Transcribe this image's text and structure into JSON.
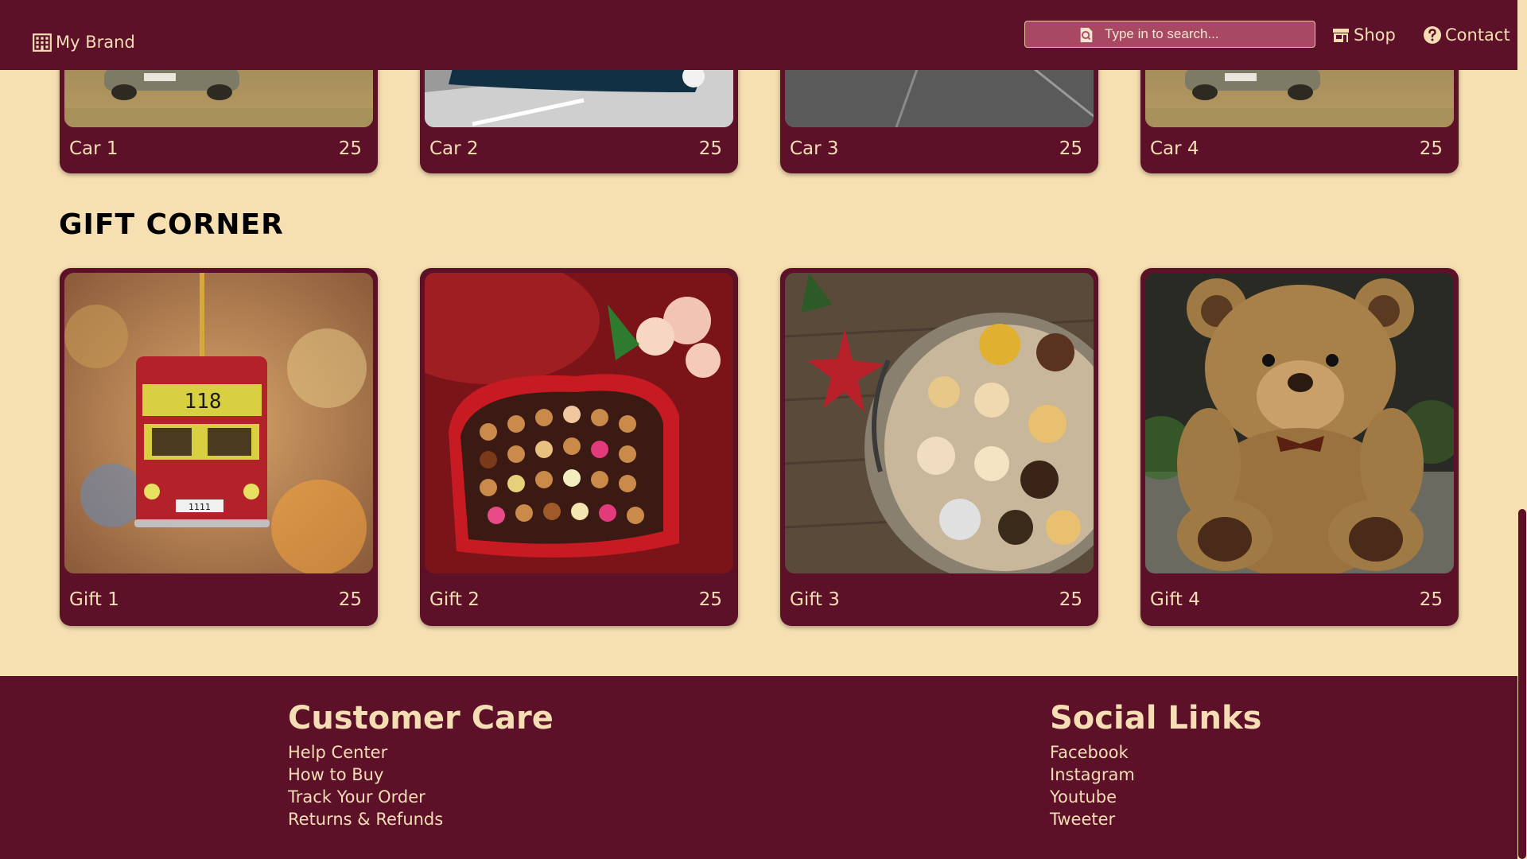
{
  "nav": {
    "brand": "My Brand",
    "search_placeholder": "Type in to search...",
    "shop": "Shop",
    "contact": "Contact"
  },
  "cars": [
    {
      "name": "Car 1",
      "price": "25"
    },
    {
      "name": "Car 2",
      "price": "25"
    },
    {
      "name": "Car 3",
      "price": "25"
    },
    {
      "name": "Car 4",
      "price": "25"
    }
  ],
  "gift_section": {
    "title": "GIFT CORNER",
    "items": [
      {
        "name": "Gift 1",
        "price": "25"
      },
      {
        "name": "Gift 2",
        "price": "25"
      },
      {
        "name": "Gift 3",
        "price": "25"
      },
      {
        "name": "Gift 4",
        "price": "25"
      }
    ]
  },
  "footer": {
    "customer_care": {
      "title": "Customer Care",
      "links": [
        "Help Center",
        "How to Buy",
        "Track Your Order",
        "Returns & Refunds"
      ]
    },
    "social": {
      "title": "Social Links",
      "links": [
        "Facebook",
        "Instagram",
        "Youtube",
        "Tweeter"
      ]
    }
  },
  "colors": {
    "primary": "#5c1129",
    "background": "#f6dfb1",
    "text_light": "#f5deb3",
    "search_bg": "#a84863"
  },
  "icons": {
    "brand": "building-icon",
    "search": "search-icon",
    "shop": "store-icon",
    "contact": "question-circle-icon"
  }
}
